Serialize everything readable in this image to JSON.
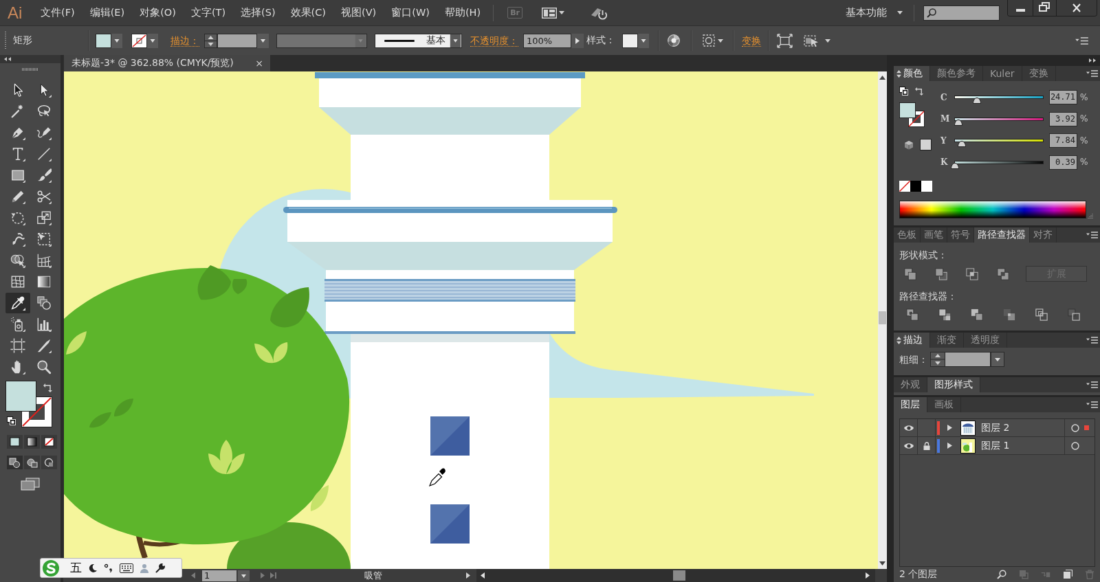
{
  "menu_bar": {
    "logo": "Ai",
    "items": [
      "文件(F)",
      "编辑(E)",
      "对象(O)",
      "文字(T)",
      "选择(S)",
      "效果(C)",
      "视图(V)",
      "窗口(W)",
      "帮助(H)"
    ],
    "bridge_button": "Br",
    "workspace": "基本功能"
  },
  "control_bar": {
    "tool_name": "矩形",
    "stroke_label": "描边：",
    "stroke_profile": "基本",
    "opacity_label": "不透明度：",
    "opacity_value": "100%",
    "style_label": "样式：",
    "transform_link": "变换"
  },
  "document_tab": {
    "title": "未标题-3* @ 362.88% (CMYK/预览)",
    "close": "×"
  },
  "toolbar": {
    "tools": [
      {
        "selected": false
      },
      {
        "selected": false
      },
      {
        "selected": false
      },
      {
        "selected": false
      },
      {
        "selected": false
      },
      {
        "selected": false
      },
      {
        "selected": false
      },
      {
        "selected": false
      },
      {
        "selected": false
      },
      {
        "selected": false
      },
      {
        "selected": false
      },
      {
        "selected": false
      },
      {
        "selected": false
      },
      {
        "selected": false
      },
      {
        "selected": false
      },
      {
        "selected": false
      },
      {
        "selected": false
      },
      {
        "selected": false
      },
      {
        "selected": false
      },
      {
        "selected": false
      },
      {
        "selected": true
      },
      {
        "selected": false
      },
      {
        "selected": false
      },
      {
        "selected": false
      },
      {
        "selected": false
      },
      {
        "selected": false
      },
      {
        "selected": false
      },
      {
        "selected": false
      }
    ]
  },
  "color_panel": {
    "options_toggle": true,
    "tabs": [
      {
        "label": "颜色",
        "selected": true
      },
      {
        "label": "颜色参考",
        "selected": false
      },
      {
        "label": "Kuler",
        "selected": false
      },
      {
        "label": "变换",
        "selected": false
      }
    ],
    "sliders": [
      {
        "label": "C",
        "value": "24.71",
        "unit": "%",
        "level": 0.2471
      },
      {
        "label": "M",
        "value": "3.92",
        "unit": "%",
        "level": 0.0392
      },
      {
        "label": "Y",
        "value": "7.84",
        "unit": "%",
        "level": 0.0784
      },
      {
        "label": "K",
        "value": "0.39",
        "unit": "%",
        "level": 0.0039
      }
    ]
  },
  "pathfinder_panel": {
    "tabs": [
      {
        "label": "色板",
        "selected": false
      },
      {
        "label": "画笔",
        "selected": false
      },
      {
        "label": "符号",
        "selected": false
      },
      {
        "label": "路径查找器",
        "selected": true
      },
      {
        "label": "对齐",
        "selected": false
      }
    ],
    "shape_modes_label": "形状模式：",
    "expand_button": {
      "label": "扩展",
      "disabled": true
    },
    "pathfinders_label": "路径查找器："
  },
  "stroke_panel": {
    "options_toggle": true,
    "tabs": [
      {
        "label": "描边",
        "selected": true
      },
      {
        "label": "渐变",
        "selected": false
      },
      {
        "label": "透明度",
        "selected": false
      }
    ],
    "weight_label": "粗细："
  },
  "appearance_panel": {
    "tabs": [
      {
        "label": "外观",
        "selected": false
      },
      {
        "label": "图形样式",
        "selected": true
      }
    ]
  },
  "layers_panel": {
    "tabs": [
      {
        "label": "图层",
        "selected": true
      },
      {
        "label": "画板",
        "selected": false
      }
    ],
    "layers": [
      {
        "name": "图层 2",
        "color": "#e8453c",
        "visible": true,
        "locked": false,
        "expanded": false,
        "selected": false,
        "has_selected_art": true
      },
      {
        "name": "图层 1",
        "color": "#4a78e0",
        "visible": true,
        "locked": true,
        "expanded": false,
        "selected": false,
        "has_selected_art": false
      }
    ],
    "count": "2 个图层"
  },
  "status_bar": {
    "page": "1",
    "current_tool": "吸管"
  },
  "ime_bar": {
    "mode": "五"
  }
}
